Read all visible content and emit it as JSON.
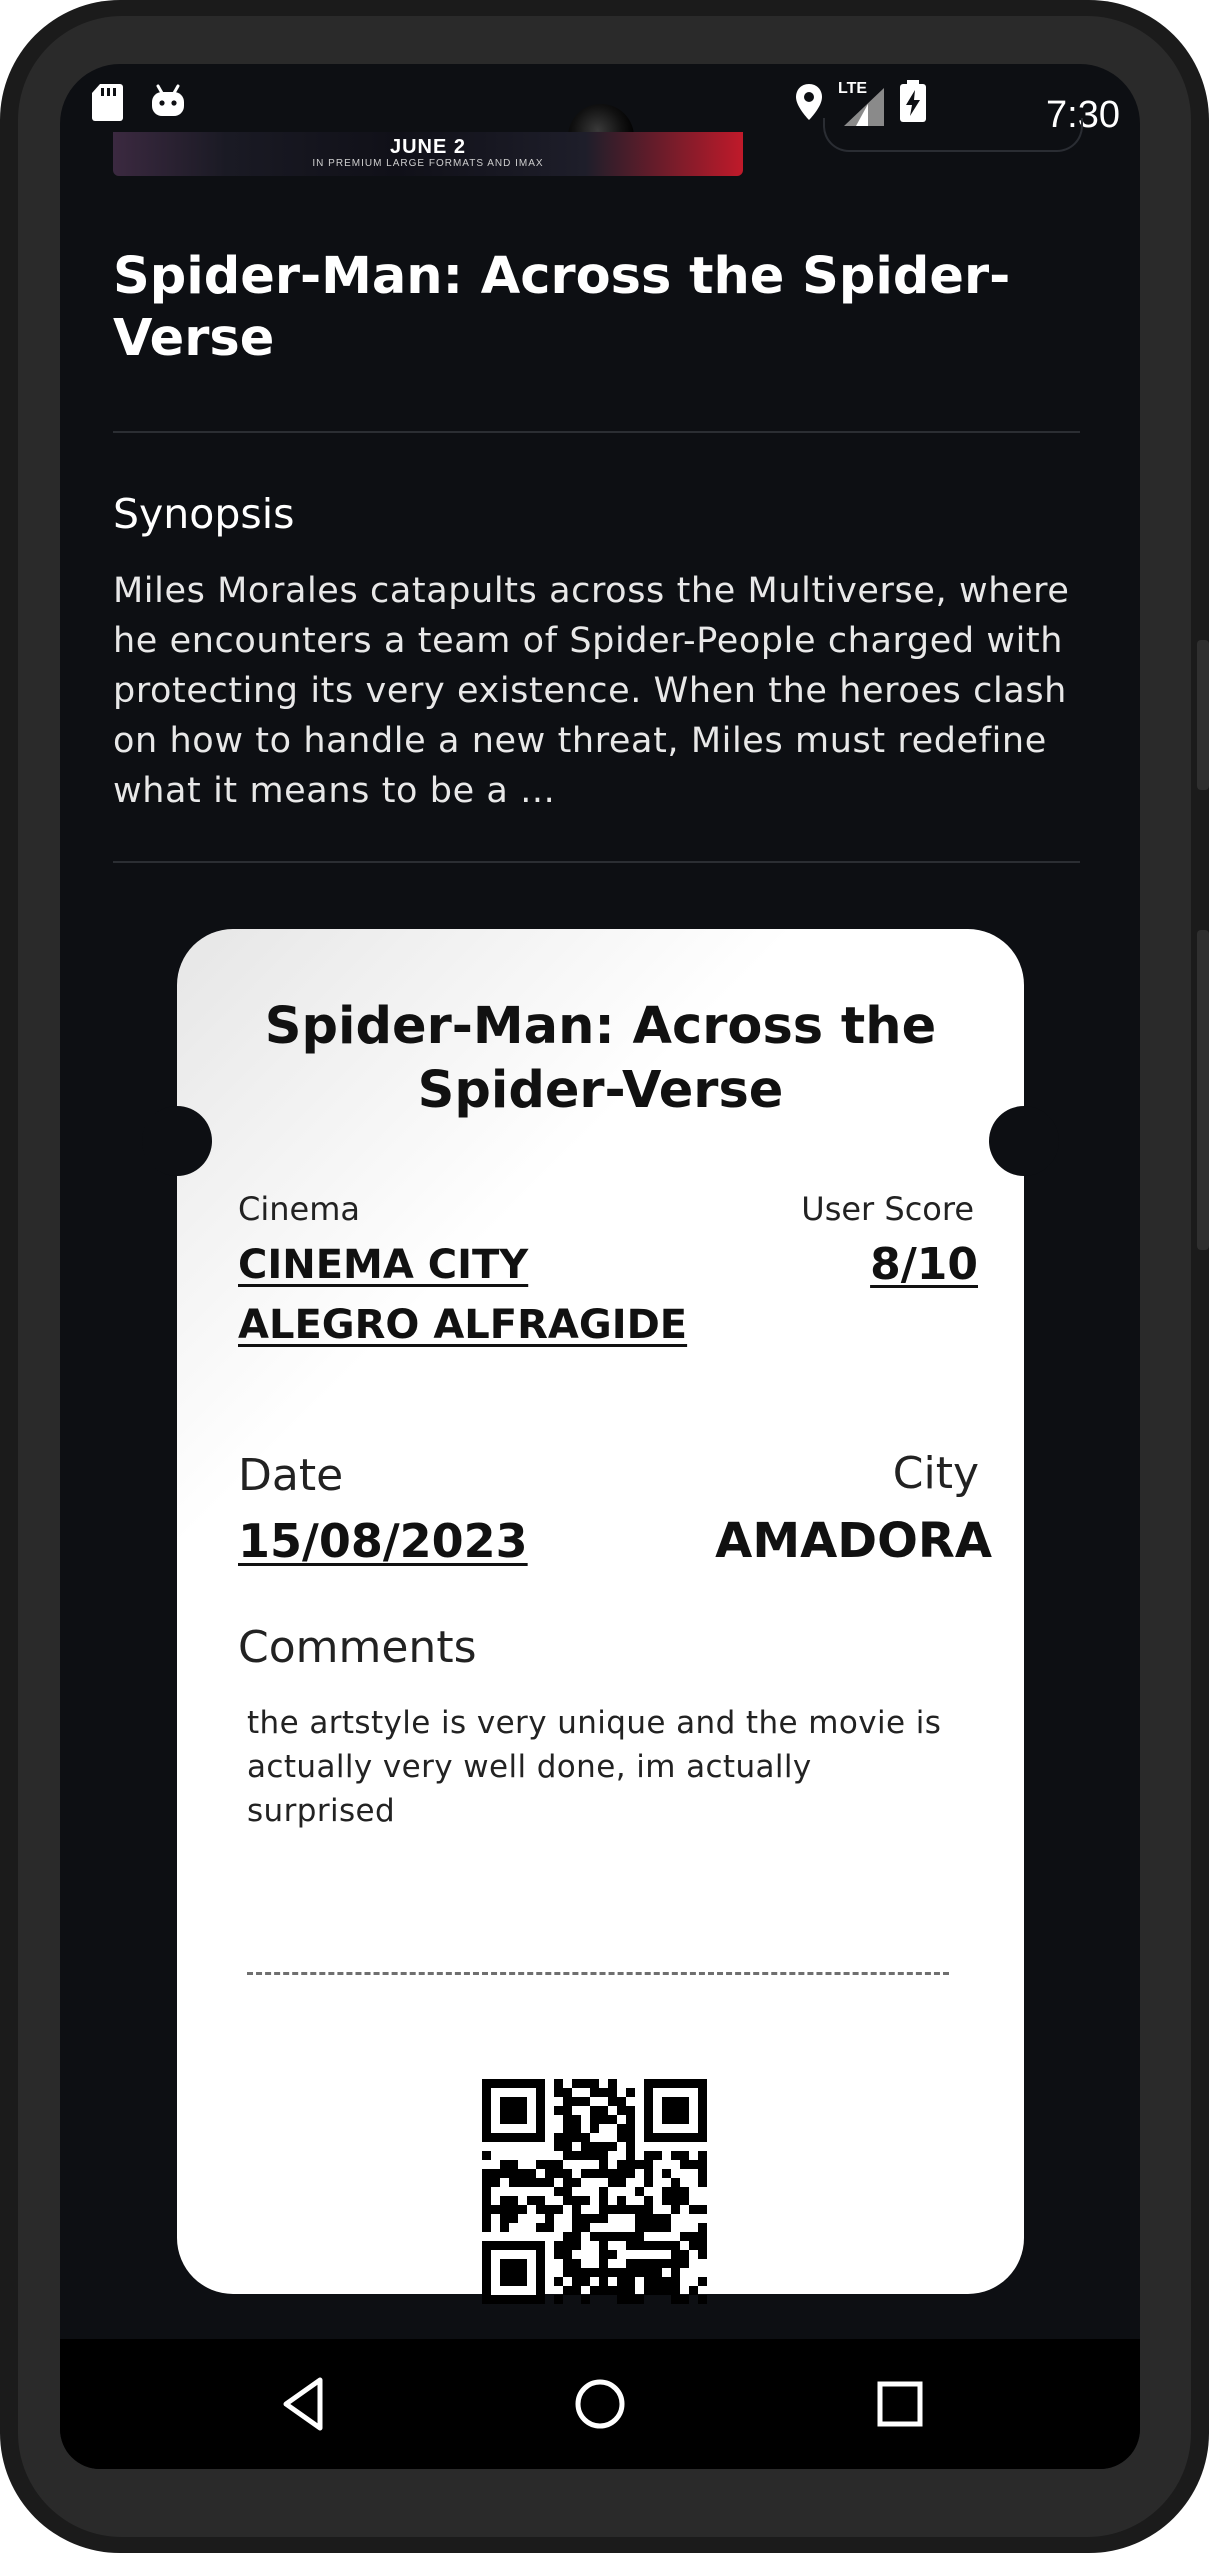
{
  "status_bar": {
    "time": "7:30",
    "network": "LTE",
    "icons": [
      "sd-card-icon",
      "android-icon",
      "location-icon",
      "signal-icon",
      "battery-charging-icon"
    ]
  },
  "banner": {
    "date": "JUNE 2",
    "subtitle": "IN PREMIUM LARGE FORMATS AND IMAX"
  },
  "movie": {
    "title": "Spider-Man: Across the Spider-Verse",
    "synopsis_heading": "Synopsis",
    "synopsis": "Miles Morales catapults across the Multiverse, where he encounters a team of Spider-People charged with protecting its very existence. When the heroes clash on how to handle a new threat, Miles must redefine what it means to be a ..."
  },
  "ticket": {
    "title": "Spider-Man: Across the Spider-Verse",
    "cinema_label": "Cinema",
    "cinema_value": "CINEMA CITY ALEGRO ALFRAGIDE",
    "score_label": "User Score",
    "score_value": "8/10",
    "date_label": "Date",
    "date_value": "15/08/2023",
    "city_label": "City",
    "city_value": "AMADORA",
    "comments_label": "Comments",
    "comments_value": "the artstyle is very unique and the movie is actually very well done, im actually surprised"
  },
  "nav_bar": {
    "buttons": [
      "back-icon",
      "home-icon",
      "recents-icon"
    ]
  },
  "colors": {
    "screen_background": "#0d0f13",
    "ticket_background": "#ffffff",
    "text_primary": "#ffffff",
    "ticket_text": "#111111"
  }
}
